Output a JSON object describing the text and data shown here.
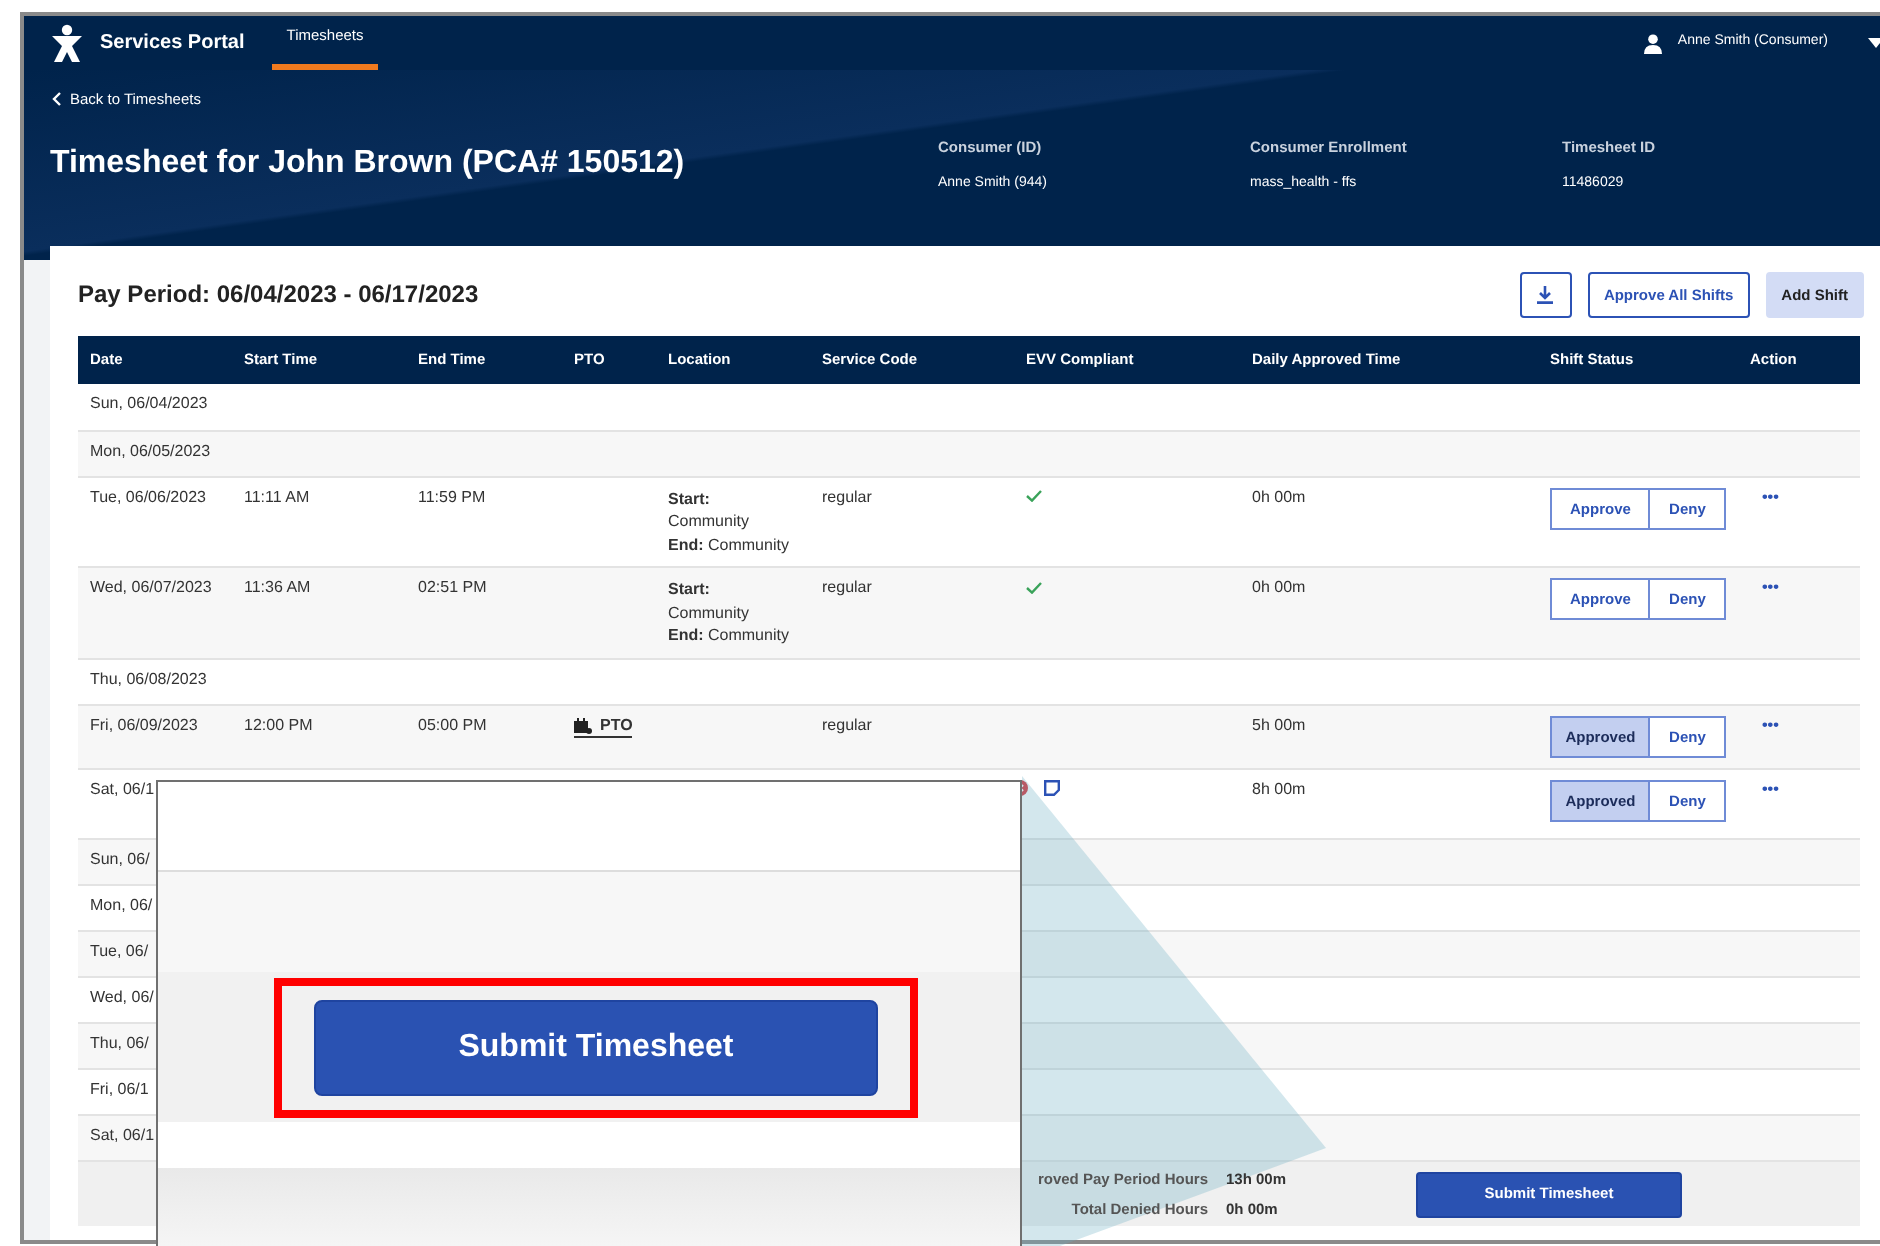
{
  "nav": {
    "brand": "Services Portal",
    "tabs": [
      {
        "label": "Timesheets",
        "selected": true
      }
    ],
    "user": "Anne Smith (Consumer)"
  },
  "header": {
    "back_link": "Back to Timesheets",
    "title": "Timesheet for John Brown (PCA# 150512)",
    "info": [
      {
        "label": "Consumer (ID)",
        "value": "Anne Smith (944)"
      },
      {
        "label": "Consumer Enrollment",
        "value": "mass_health - ffs"
      },
      {
        "label": "Timesheet ID",
        "value": "11486029"
      }
    ]
  },
  "pay_period": {
    "title": "Pay Period: 06/04/2023 - 06/17/2023",
    "buttons": [
      {
        "kind": "download"
      },
      {
        "kind": "outline",
        "label": "Approve All Shifts"
      },
      {
        "kind": "soft",
        "label": "Add Shift"
      }
    ]
  },
  "table": {
    "columns": [
      "Date",
      "Start Time",
      "End Time",
      "PTO",
      "Location",
      "Service Code",
      "EVV Compliant",
      "Daily Approved Time",
      "Shift Status",
      "Action"
    ],
    "rows": [
      {
        "kind": "day",
        "date": "Sun, 06/04/2023"
      },
      {
        "kind": "day",
        "date": "Mon, 06/05/2023"
      },
      {
        "kind": "shift",
        "date": "Tue, 06/06/2023",
        "start": "11:11 AM",
        "end": "11:59 PM",
        "location": [
          "**Start:** Community",
          "**End:** Community"
        ],
        "service_code": "regular",
        "evv_compliant": true,
        "daily": "0h 00m",
        "approve": {
          "label": "Approve",
          "selected": false
        },
        "deny": {
          "label": "Deny",
          "selected": false
        },
        "action": "•••"
      },
      {
        "kind": "shift",
        "date": "Wed, 06/07/2023",
        "start": "11:36 AM",
        "end": "02:51 PM",
        "location": [
          "**Start:** Community",
          "**End:** Community"
        ],
        "service_code": "regular",
        "evv_compliant": true,
        "daily": "0h 00m",
        "approve": {
          "label": "Approve",
          "selected": false
        },
        "deny": {
          "label": "Deny",
          "selected": false
        },
        "action": "•••"
      },
      {
        "kind": "day",
        "date": "Thu, 06/08/2023"
      },
      {
        "kind": "shift",
        "date": "Fri, 06/09/2023",
        "start": "12:00 PM",
        "end": "05:00 PM",
        "pto": "PTO",
        "service_code": "regular",
        "daily": "5h 00m",
        "approve": {
          "label": "Approved",
          "selected": true
        },
        "deny": {
          "label": "Deny",
          "selected": false
        },
        "action": "•••"
      },
      {
        "kind": "shift",
        "date": "Sat, 06/1",
        "evv_compliant": false,
        "has_note": true,
        "daily": "8h 00m",
        "approve": {
          "label": "Approved",
          "selected": true
        },
        "deny": {
          "label": "Deny",
          "selected": false
        },
        "action": "•••"
      },
      {
        "kind": "day",
        "date": "Sun, 06/"
      },
      {
        "kind": "day",
        "date": "Mon, 06/"
      },
      {
        "kind": "day",
        "date": "Tue, 06/"
      },
      {
        "kind": "day",
        "date": "Wed, 06/"
      },
      {
        "kind": "day",
        "date": "Thu, 06/"
      },
      {
        "kind": "day",
        "date": "Fri, 06/1"
      },
      {
        "kind": "day",
        "date": "Sat, 06/1"
      }
    ]
  },
  "totals": [
    {
      "label": "roved Pay Period Hours",
      "value": "13h 00m"
    },
    {
      "label": "Total Denied Hours",
      "value": "0h 00m"
    }
  ],
  "submit_button": "Submit Timesheet",
  "callout": {
    "submit_button": "Submit Timesheet",
    "highlighted": true
  }
}
